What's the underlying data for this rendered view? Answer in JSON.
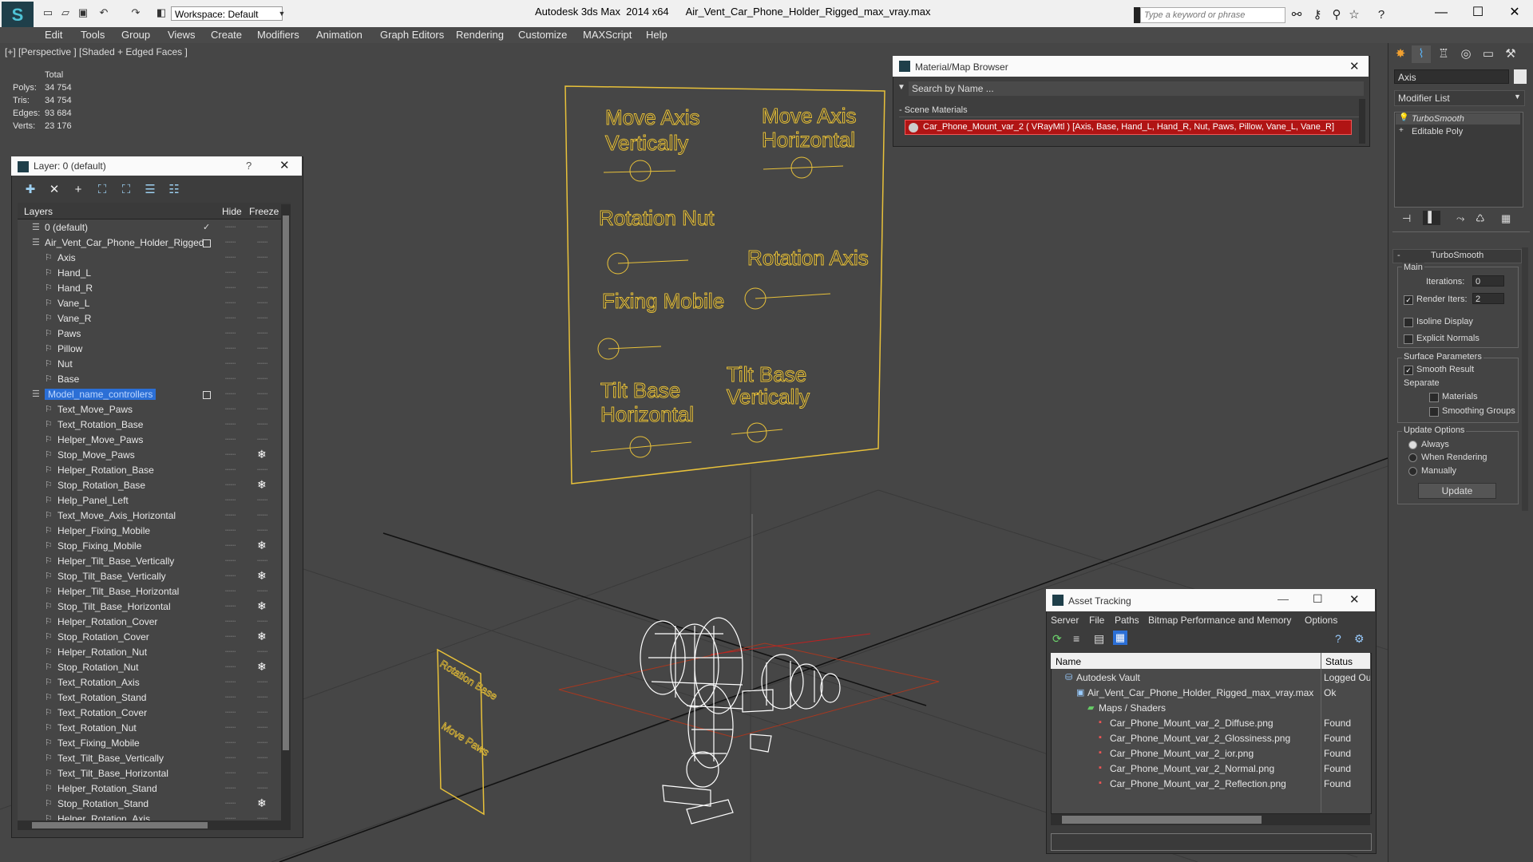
{
  "titlebar": {
    "workspace": "Workspace: Default",
    "title": "Autodesk 3ds Max  2014 x64      Air_Vent_Car_Phone_Holder_Rigged_max_vray.max",
    "search_placeholder": "Type a keyword or phrase"
  },
  "menu": [
    "Edit",
    "Tools",
    "Group",
    "Views",
    "Create",
    "Modifiers",
    "Animation",
    "Graph Editors",
    "Rendering",
    "Customize",
    "MAXScript",
    "Help"
  ],
  "viewport": {
    "label": "[+] [Perspective ] [Shaded + Edged Faces ]",
    "stats_header": "Total",
    "stats": [
      {
        "label": "Polys:",
        "value": "34 754"
      },
      {
        "label": "Tris:",
        "value": "34 754"
      },
      {
        "label": "Edges:",
        "value": "93 684"
      },
      {
        "label": "Verts:",
        "value": "23 176"
      }
    ],
    "panel_texts": [
      "Move Axis",
      "Vertically",
      "Move Axis",
      "Horizontal",
      "Rotation Nut",
      "Rotation Axis",
      "Fixing Mobile",
      "Tilt Base",
      "Horizontal",
      "Tilt Base",
      "Vertically"
    ],
    "small_panel_texts": [
      "Rotation Base",
      "Move Paws"
    ]
  },
  "layer_panel": {
    "title": "Layer: 0 (default)",
    "help": "?",
    "col_layers": "Layers",
    "col_hide": "Hide",
    "col_freeze": "Freeze",
    "rows": [
      {
        "name": "0 (default)",
        "indent": 0,
        "check": "✓"
      },
      {
        "name": "Air_Vent_Car_Phone_Holder_Rigged",
        "indent": 0,
        "box": true
      },
      {
        "name": "Axis",
        "indent": 1
      },
      {
        "name": "Hand_L",
        "indent": 1
      },
      {
        "name": "Hand_R",
        "indent": 1
      },
      {
        "name": "Vane_L",
        "indent": 1
      },
      {
        "name": "Vane_R",
        "indent": 1
      },
      {
        "name": "Paws",
        "indent": 1
      },
      {
        "name": "Pillow",
        "indent": 1
      },
      {
        "name": "Nut",
        "indent": 1
      },
      {
        "name": "Base",
        "indent": 1
      },
      {
        "name": "Model_name_controllers",
        "indent": 0,
        "box": true,
        "selected": true
      },
      {
        "name": "Text_Move_Paws",
        "indent": 1
      },
      {
        "name": "Text_Rotation_Base",
        "indent": 1
      },
      {
        "name": "Helper_Move_Paws",
        "indent": 1
      },
      {
        "name": "Stop_Move_Paws",
        "indent": 1,
        "frozen": true
      },
      {
        "name": "Helper_Rotation_Base",
        "indent": 1
      },
      {
        "name": "Stop_Rotation_Base",
        "indent": 1,
        "frozen": true
      },
      {
        "name": "Help_Panel_Left",
        "indent": 1
      },
      {
        "name": "Text_Move_Axis_Horizontal",
        "indent": 1
      },
      {
        "name": "Helper_Fixing_Mobile",
        "indent": 1
      },
      {
        "name": "Stop_Fixing_Mobile",
        "indent": 1,
        "frozen": true
      },
      {
        "name": "Helper_Tilt_Base_Vertically",
        "indent": 1
      },
      {
        "name": "Stop_Tilt_Base_Vertically",
        "indent": 1,
        "frozen": true
      },
      {
        "name": "Helper_Tilt_Base_Horizontal",
        "indent": 1
      },
      {
        "name": "Stop_Tilt_Base_Horizontal",
        "indent": 1,
        "frozen": true
      },
      {
        "name": "Helper_Rotation_Cover",
        "indent": 1
      },
      {
        "name": "Stop_Rotation_Cover",
        "indent": 1,
        "frozen": true
      },
      {
        "name": "Helper_Rotation_Nut",
        "indent": 1
      },
      {
        "name": "Stop_Rotation_Nut",
        "indent": 1,
        "frozen": true
      },
      {
        "name": "Text_Rotation_Axis",
        "indent": 1
      },
      {
        "name": "Text_Rotation_Stand",
        "indent": 1
      },
      {
        "name": "Text_Rotation_Cover",
        "indent": 1
      },
      {
        "name": "Text_Rotation_Nut",
        "indent": 1
      },
      {
        "name": "Text_Fixing_Mobile",
        "indent": 1
      },
      {
        "name": "Text_Tilt_Base_Vertically",
        "indent": 1
      },
      {
        "name": "Text_Tilt_Base_Horizontal",
        "indent": 1
      },
      {
        "name": "Helper_Rotation_Stand",
        "indent": 1
      },
      {
        "name": "Stop_Rotation_Stand",
        "indent": 1,
        "frozen": true
      },
      {
        "name": "Helper_Rotation_Axis",
        "indent": 1
      }
    ]
  },
  "material_browser": {
    "title": "Material/Map Browser",
    "search_placeholder": "Search by Name ...",
    "section": "- Scene Materials",
    "item": "Car_Phone_Mount_var_2  ( VRayMtl ) [Axis, Base, Hand_L, Hand_R, Nut, Paws, Pillow, Vane_L, Vane_R]"
  },
  "command_panel": {
    "object_name": "Axis",
    "modifier_list": "Modifier List",
    "stack": [
      "TurboSmooth",
      "Editable Poly"
    ],
    "rollout": "TurboSmooth",
    "main": "Main",
    "iterations_label": "Iterations:",
    "iterations_value": "0",
    "render_iters_label": "Render Iters:",
    "render_iters_value": "2",
    "isoline": "Isoline Display",
    "explicit_normals": "Explicit Normals",
    "surface_params": "Surface Parameters",
    "smooth_result": "Smooth Result",
    "separate": "Separate",
    "materials": "Materials",
    "smoothing_groups": "Smoothing Groups",
    "update_options": "Update Options",
    "always": "Always",
    "when_rendering": "When Rendering",
    "manually": "Manually",
    "update_button": "Update"
  },
  "asset_tracking": {
    "title": "Asset Tracking",
    "menu": [
      "Server",
      "File",
      "Paths",
      "Bitmap Performance and Memory",
      "Options"
    ],
    "col_name": "Name",
    "col_status": "Status",
    "rows": [
      {
        "name": "Autodesk Vault",
        "status": "Logged Ou",
        "indent": 1
      },
      {
        "name": "Air_Vent_Car_Phone_Holder_Rigged_max_vray.max",
        "status": "Ok",
        "indent": 2
      },
      {
        "name": "Maps / Shaders",
        "status": "",
        "indent": 3
      },
      {
        "name": "Car_Phone_Mount_var_2_Diffuse.png",
        "status": "Found",
        "indent": 4
      },
      {
        "name": "Car_Phone_Mount_var_2_Glossiness.png",
        "status": "Found",
        "indent": 4
      },
      {
        "name": "Car_Phone_Mount_var_2_ior.png",
        "status": "Found",
        "indent": 4
      },
      {
        "name": "Car_Phone_Mount_var_2_Normal.png",
        "status": "Found",
        "indent": 4
      },
      {
        "name": "Car_Phone_Mount_var_2_Reflection.png",
        "status": "Found",
        "indent": 4
      }
    ]
  },
  "colors": {
    "selection": "#2b6fd6",
    "viewport_text": "#e8c13a",
    "material_highlight": "#b01414"
  }
}
